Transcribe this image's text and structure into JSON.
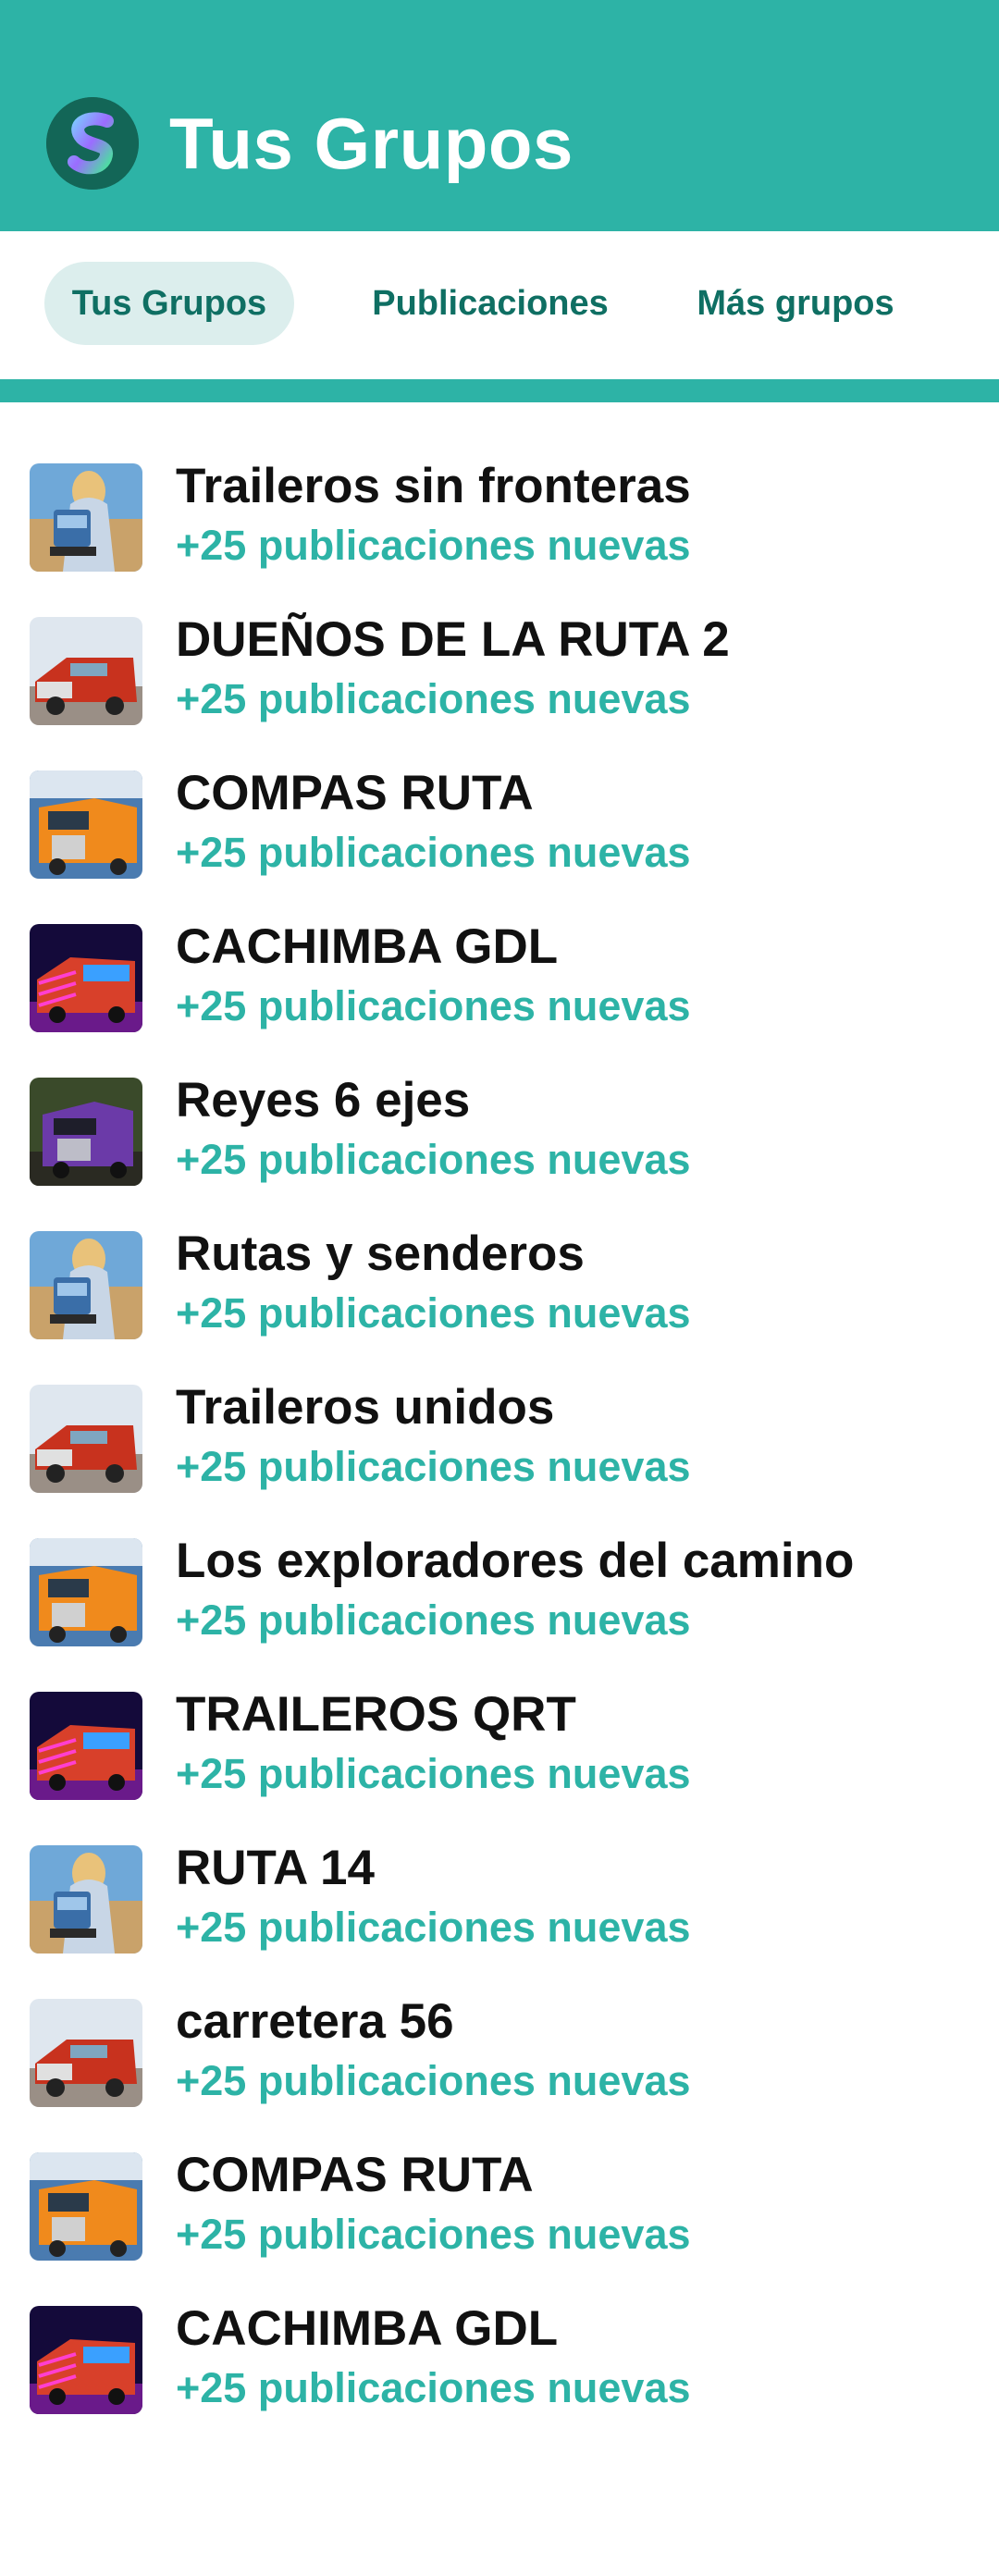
{
  "header": {
    "title": "Tus Grupos",
    "logo_icon": "app-logo-icon",
    "background": "#2db3a6"
  },
  "tabs": [
    {
      "label": "Tus Grupos",
      "active": true
    },
    {
      "label": "Publicaciones",
      "active": false
    },
    {
      "label": "Más grupos",
      "active": false
    }
  ],
  "accent_color": "#2db3a6",
  "groups": [
    {
      "name": "Traileros sin fronteras",
      "subtitle": "+25 publicaciones nuevas",
      "thumb": "jesus-truck-thumb"
    },
    {
      "name": "DUEÑOS DE LA RUTA 2",
      "subtitle": "+25 publicaciones nuevas",
      "thumb": "red-truck-thumb"
    },
    {
      "name": "COMPAS RUTA",
      "subtitle": "+25 publicaciones nuevas",
      "thumb": "orange-truck-thumb"
    },
    {
      "name": "CACHIMBA GDL",
      "subtitle": "+25 publicaciones nuevas",
      "thumb": "neon-truck-thumb"
    },
    {
      "name": "Reyes 6 ejes",
      "subtitle": "+25 publicaciones nuevas",
      "thumb": "purple-truck-thumb"
    },
    {
      "name": "Rutas y senderos",
      "subtitle": "+25 publicaciones nuevas",
      "thumb": "jesus-truck-thumb"
    },
    {
      "name": "Traileros unidos",
      "subtitle": "+25 publicaciones nuevas",
      "thumb": "red-truck-thumb"
    },
    {
      "name": "Los exploradores del camino",
      "subtitle": "+25 publicaciones nuevas",
      "thumb": "orange-truck-thumb"
    },
    {
      "name": "TRAILEROS QRT",
      "subtitle": "+25 publicaciones nuevas",
      "thumb": "neon-truck-thumb"
    },
    {
      "name": "RUTA 14",
      "subtitle": "+25 publicaciones nuevas",
      "thumb": "jesus-truck-thumb"
    },
    {
      "name": "carretera 56",
      "subtitle": "+25 publicaciones nuevas",
      "thumb": "red-truck-thumb"
    },
    {
      "name": "COMPAS RUTA",
      "subtitle": "+25 publicaciones nuevas",
      "thumb": "orange-truck-thumb"
    },
    {
      "name": "CACHIMBA GDL",
      "subtitle": "+25 publicaciones nuevas",
      "thumb": "neon-truck-thumb"
    }
  ]
}
